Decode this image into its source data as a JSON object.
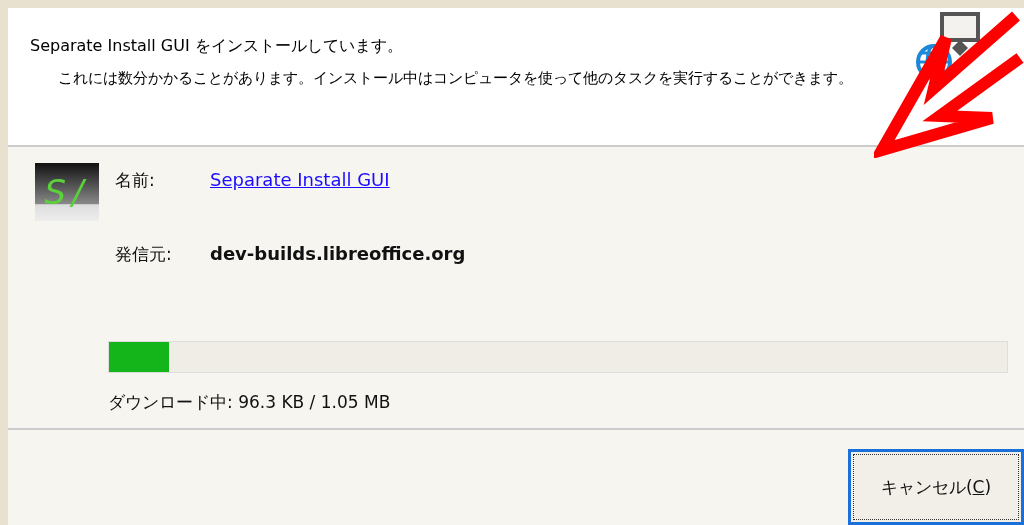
{
  "header": {
    "title": "Separate Install GUI をインストールしています。",
    "description": "これには数分かかることがあります。インストール中はコンピュータを使って他のタスクを実行することができます。"
  },
  "app": {
    "logo_text": "S/",
    "fields": [
      {
        "label": "名前:",
        "value": "Separate Install GUI",
        "kind": "link"
      },
      {
        "label": "発信元:",
        "value": "dev-builds.libreoffice.org",
        "kind": "bold"
      }
    ]
  },
  "progress": {
    "level": 0.067,
    "status": "ダウンロード中: 96.3 KB / 1.05 MB"
  },
  "cancel_button": {
    "label_before": "キャンセル(",
    "accelerator": "C",
    "label_after": ")",
    "focused": true
  }
}
